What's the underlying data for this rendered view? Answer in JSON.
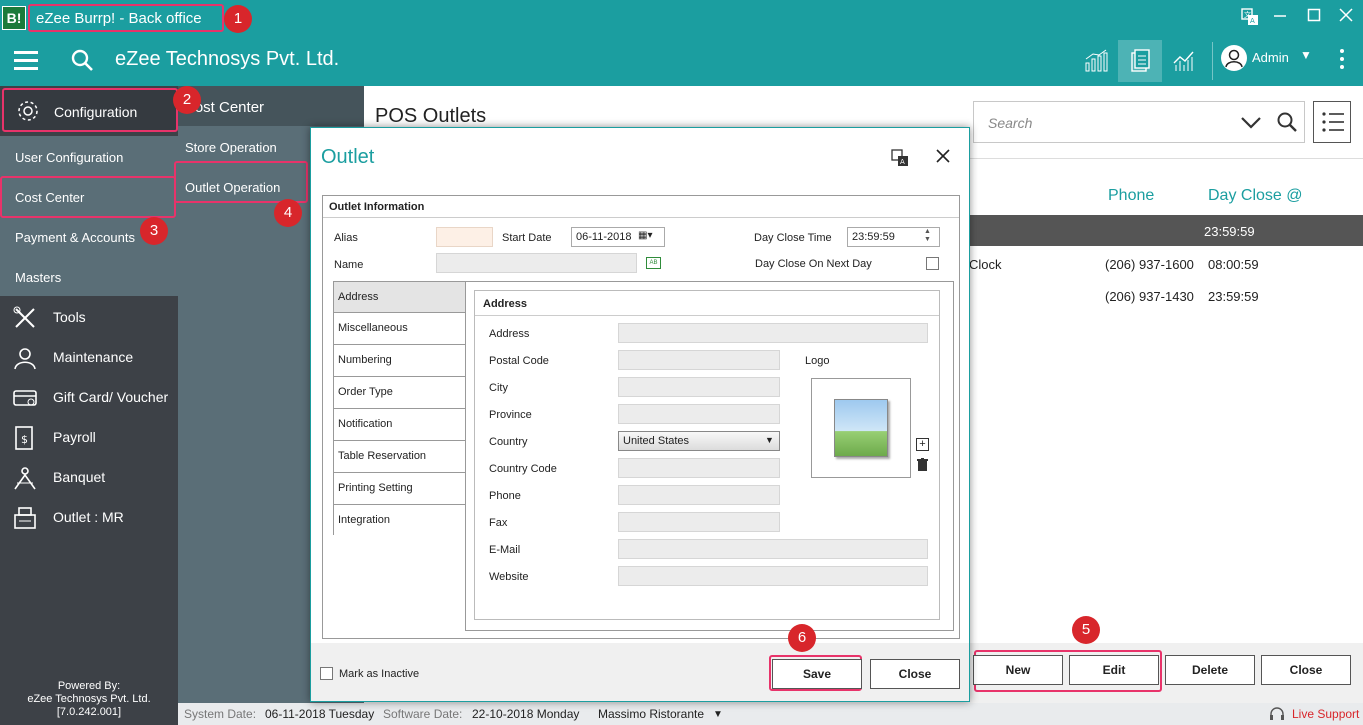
{
  "window": {
    "logo_text": "B!",
    "title": "eZee Burrp! - Back office"
  },
  "toolbar": {
    "company": "eZee Technosys Pvt. Ltd.",
    "user": "Admin"
  },
  "sidebar": {
    "configuration": "Configuration",
    "sub_items": [
      "User Configuration",
      "Cost Center",
      "Payment & Accounts",
      "Masters"
    ],
    "items": [
      {
        "label": "Tools",
        "icon": "tools-icon"
      },
      {
        "label": "Maintenance",
        "icon": "maintenance-icon"
      },
      {
        "label": "Gift Card/ Voucher",
        "icon": "gift-card-icon"
      },
      {
        "label": "Payroll",
        "icon": "payroll-icon"
      },
      {
        "label": "Banquet",
        "icon": "banquet-icon"
      },
      {
        "label": "Outlet : MR",
        "icon": "outlet-icon"
      }
    ],
    "powered_by": [
      "Powered By:",
      "eZee Technosys Pvt. Ltd.",
      "[7.0.242.001]"
    ]
  },
  "cost_center": {
    "header": "Cost Center",
    "items": [
      "Store Operation",
      "Outlet Operation"
    ]
  },
  "main": {
    "title": "POS Outlets",
    "search_placeholder": "Search",
    "columns": [
      "Phone",
      "Day Close @"
    ],
    "rows": [
      {
        "name": "",
        "phone": "",
        "day_close": "23:59:59"
      },
      {
        "name": "Clock",
        "phone": "(206) 937-1600",
        "day_close": "08:00:59"
      },
      {
        "name": "",
        "phone": "(206) 937-1430",
        "day_close": "23:59:59"
      }
    ],
    "buttons": {
      "new": "New",
      "edit": "Edit",
      "delete": "Delete",
      "close": "Close"
    }
  },
  "status": {
    "system_date_label": "System Date:",
    "system_date": "06-11-2018 Tuesday",
    "software_date_label": "Software Date:",
    "software_date": "22-10-2018 Monday",
    "outlet": "Massimo Ristorante",
    "live_support": "Live Support"
  },
  "dialog": {
    "title": "Outlet",
    "section": "Outlet Information",
    "alias_label": "Alias",
    "alias_value": "",
    "start_date_label": "Start Date",
    "start_date": "06-11-2018",
    "day_close_time_label": "Day Close Time",
    "day_close_time": "23:59:59",
    "name_label": "Name",
    "name_value": "",
    "day_close_next_label": "Day Close On Next Day",
    "tabs": [
      "Address",
      "Miscellaneous",
      "Numbering",
      "Order Type",
      "Notification",
      "Table Reservation",
      "Printing Setting",
      "Integration"
    ],
    "address": {
      "title": "Address",
      "fields": [
        "Address",
        "Postal Code",
        "City",
        "Province",
        "Country",
        "Country Code",
        "Phone",
        "Fax",
        "E-Mail",
        "Website"
      ],
      "country_value": "United States",
      "logo_label": "Logo"
    },
    "mark_inactive": "Mark as Inactive",
    "save": "Save",
    "close": "Close"
  },
  "badges": [
    "1",
    "2",
    "3",
    "4",
    "5",
    "6"
  ],
  "colors": {
    "teal": "#1b9ea0",
    "highlight": "#e8336a",
    "badge": "#d8262b",
    "sidebar": "#3d4147"
  }
}
